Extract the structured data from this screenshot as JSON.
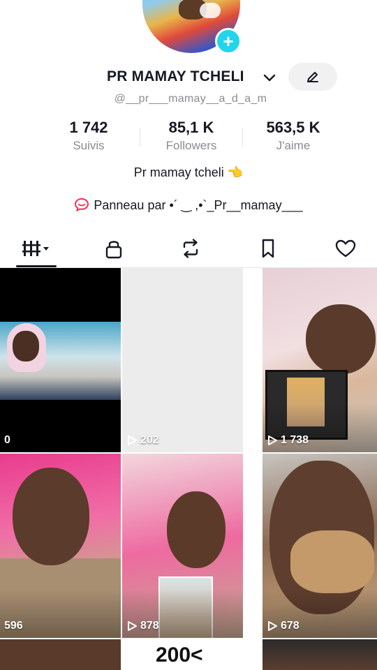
{
  "profile": {
    "name": "PR MAMAY TCHELI",
    "handle": "@__pr___mamay__a_d_a_m",
    "bio": "Pr mamay tcheli 👈",
    "panel_text": "Panneau par •´ ‿ ,•`_Pr__mamay___",
    "accent_color": "#20d5ec"
  },
  "stats": [
    {
      "value": "1 742",
      "label": "Suivis"
    },
    {
      "value": "85,1 K",
      "label": "Followers"
    },
    {
      "value": "563,5 K",
      "label": "J'aime"
    }
  ],
  "tabs": [
    {
      "icon": "videos-grid-icon",
      "active": true
    },
    {
      "icon": "lock-icon",
      "active": false
    },
    {
      "icon": "repost-icon",
      "active": false
    },
    {
      "icon": "bookmark-icon",
      "active": false
    },
    {
      "icon": "heart-icon",
      "active": false
    }
  ],
  "videos": [
    {
      "views": "0",
      "play_icon": false
    },
    {
      "views": "202",
      "play_icon": true
    },
    {
      "views": "1 738",
      "play_icon": true
    },
    {
      "views": "596",
      "play_icon": false
    },
    {
      "views": "878",
      "play_icon": true
    },
    {
      "views": "678",
      "play_icon": true
    }
  ],
  "partial_row": {
    "thumb_text": "200<"
  }
}
